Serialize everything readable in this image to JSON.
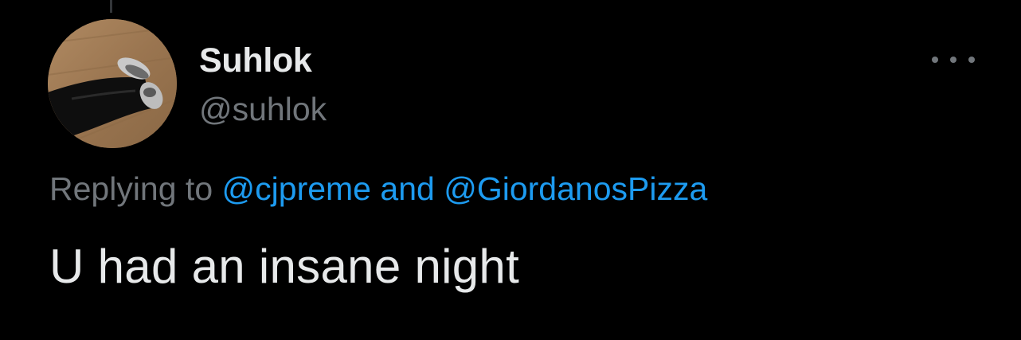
{
  "tweet": {
    "author": {
      "display_name": "Suhlok",
      "handle": "@suhlok",
      "avatar_icon": "profile-photo"
    },
    "menu_icon": "more-dots-icon",
    "reply_context": {
      "prefix": "Replying to",
      "mention_1": "@cjpreme",
      "conjunction": "and",
      "mention_2": "@GiordanosPizza"
    },
    "text": "U had an insane night"
  },
  "colors": {
    "background": "#000000",
    "primary_text": "#e7e9ea",
    "secondary_text": "#71767b",
    "link": "#1d9bf0"
  }
}
